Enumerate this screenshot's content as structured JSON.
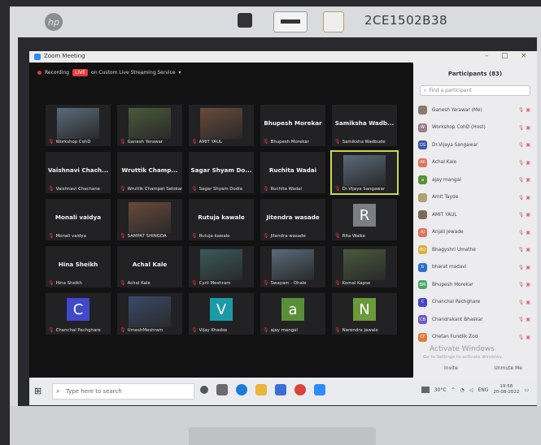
{
  "laptop": {
    "serial": "2CE1502B38",
    "brand": "hp"
  },
  "window": {
    "title": "Zoom Meeting"
  },
  "recording": {
    "label": "Recording",
    "live": "LIVE",
    "service": "on Custom Live Streaming Service"
  },
  "tiles": [
    {
      "name": "",
      "label": "Workshop CohD",
      "photo": true
    },
    {
      "name": "",
      "label": "Ganesh Yerawar",
      "photo": true
    },
    {
      "name": "",
      "label": "AMIT YAUL",
      "photo": true
    },
    {
      "name": "Bhupesh Morekar",
      "label": "Bhupesh Morekar"
    },
    {
      "name": "Samiksha Wadb...",
      "label": "Samiksha Wadbude"
    },
    {
      "name": "Vaishnavi Chach...",
      "label": "Vaishnavi Chachane"
    },
    {
      "name": "Wruttik Champ...",
      "label": "Wruttik Champat Selokar"
    },
    {
      "name": "Sagar Shyam Do...",
      "label": "Sagar Shyam Dodia"
    },
    {
      "name": "Ruchita Wadai",
      "label": "Ruchita Wadai"
    },
    {
      "name": "",
      "label": "Dr.Vijaya Sangawar",
      "photo": true,
      "speaker": true
    },
    {
      "name": "Monali vaidya",
      "label": "Monali vaidya"
    },
    {
      "name": "",
      "label": "SAMPAT SHINGDA",
      "photo": true
    },
    {
      "name": "Rutuja kawale",
      "label": "Rutuja kawale"
    },
    {
      "name": "Jitendra wasade",
      "label": "Jitendra wasade"
    },
    {
      "name": "",
      "label": "Rita Walke",
      "avatar": "R",
      "avcolor": "#7b7e84"
    },
    {
      "name": "Hina Sheikh",
      "label": "Hina Sheikh"
    },
    {
      "name": "Achal Kale",
      "label": "Achal Kale"
    },
    {
      "name": "",
      "label": "Cyril Meshram",
      "photo": true
    },
    {
      "name": "",
      "label": "Swayam - Dhale",
      "photo": true
    },
    {
      "name": "",
      "label": "Komal Kapse",
      "photo": true
    },
    {
      "name": "",
      "label": "Chanchal Pachghare",
      "avatar": "C",
      "avcolor": "#3f49c9"
    },
    {
      "name": "",
      "label": "UmeshMeshram",
      "photo": true
    },
    {
      "name": "",
      "label": "Vijay Khadse",
      "avatar": "V",
      "avcolor": "#1b9aa8"
    },
    {
      "name": "",
      "label": "ajay mangal",
      "avatar": "a",
      "avcolor": "#5a8f3a"
    },
    {
      "name": "",
      "label": "Narendra Jawale",
      "avatar": "N",
      "avcolor": "#6a9a3a"
    }
  ],
  "participants": {
    "title": "Participants (83)",
    "search_placeholder": "Find a participant",
    "list": [
      {
        "name": "Ganesh Yerawar (Me)",
        "initials": "",
        "color": "#8a7a6a"
      },
      {
        "name": "Workshop CohD (Host)",
        "initials": "W",
        "color": "#9c7b8a"
      },
      {
        "name": "Dr.Vijaya Sangawar",
        "initials": "DS",
        "color": "#3a57a8"
      },
      {
        "name": "Achal Kale",
        "initials": "AK",
        "color": "#e0725a"
      },
      {
        "name": "ajay mangal",
        "initials": "a",
        "color": "#5a8f3a"
      },
      {
        "name": "Amit Tayde",
        "initials": "",
        "color": "#b0a070"
      },
      {
        "name": "AMIT YAUL",
        "initials": "",
        "color": "#7a6a5a"
      },
      {
        "name": "Anjali jewade",
        "initials": "AJ",
        "color": "#e0725a"
      },
      {
        "name": "Bhagyshri Umathe",
        "initials": "BU",
        "color": "#d8b040"
      },
      {
        "name": "bharat madavi",
        "initials": "b",
        "color": "#2d6fcf"
      },
      {
        "name": "Bhupesh Morekar",
        "initials": "BM",
        "color": "#4aa86a"
      },
      {
        "name": "Chanchal Pachghare",
        "initials": "C",
        "color": "#3f49c9"
      },
      {
        "name": "Chandrakant Bhaskar",
        "initials": "CB",
        "color": "#6a5ac8"
      },
      {
        "name": "Chetan Fundlik Zod",
        "initials": "CF",
        "color": "#e07a3a"
      }
    ],
    "invite": "Invite",
    "unmute": "Unmute Me",
    "activate_title": "Activate Windows",
    "activate_sub": "Go to Settings to activate Windows."
  },
  "taskbar": {
    "search": "Type here to search",
    "temp": "30°C",
    "lang": "ENG",
    "time": "19:58",
    "date": "20-08-2022"
  }
}
